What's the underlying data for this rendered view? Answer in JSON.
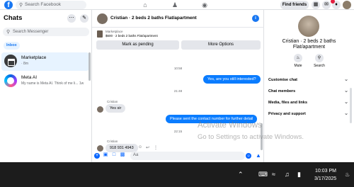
{
  "topbar": {
    "logo": "f",
    "search_placeholder": "Search Facebook",
    "find_friends": "Find friends",
    "icons": [
      "facebook-logo",
      "search-icon",
      "home-icon",
      "friends-icon",
      "groups-icon",
      "menu-grid-icon",
      "messenger-icon",
      "notifications-icon",
      "profile-avatar"
    ]
  },
  "sidebar": {
    "title": "Chats",
    "search_placeholder": "Search Messenger",
    "filter": "Inbox",
    "conversations": [
      {
        "name": "Marketplace",
        "subtitle": "· 8m",
        "active": true
      },
      {
        "name": "Meta AI",
        "subtitle": "My name is Meta AI. Think of me li...  1w",
        "active": false
      }
    ]
  },
  "conversation": {
    "title": "Cristian · 2 beds 2 baths Flat/apartment",
    "listing_label": "Marketplace",
    "listing_info": "$600 · 2 beds 2 baths Flat/apartment",
    "mark_pending": "Mark as pending",
    "more_options": "More Options",
    "messages": [
      {
        "type": "time",
        "text": "10:58"
      },
      {
        "type": "out",
        "text": "Yes, are you still interested?"
      },
      {
        "type": "time",
        "text": "21:48"
      },
      {
        "type": "sender",
        "text": "Cristian"
      },
      {
        "type": "in",
        "text": "Yes sir"
      },
      {
        "type": "out",
        "text": "Please sent the contact number for further detail"
      },
      {
        "type": "time",
        "text": "22:15"
      },
      {
        "type": "sender",
        "text": "Cristian"
      },
      {
        "type": "in",
        "text": "918 931 4943"
      }
    ],
    "composer_placeholder": "Aa"
  },
  "profile_panel": {
    "name": "Cristian · 2 beds 2 baths Flat/apartment",
    "mute_label": "Mute",
    "search_label": "Search",
    "sections": [
      "Customise chat",
      "Chat members",
      "Media, files and links",
      "Privacy and support"
    ]
  },
  "watermark": {
    "line1": "Activate Windows",
    "line2": "Go to Settings to activate Windows."
  },
  "taskbar": {
    "time": "10:03 PM",
    "date": "3/17/2025"
  },
  "colors": {
    "brand": "#1877f2",
    "bubble_out": "#0a7cff",
    "bubble_in": "#e4e6eb",
    "taskbar": "#1c1c1c"
  }
}
